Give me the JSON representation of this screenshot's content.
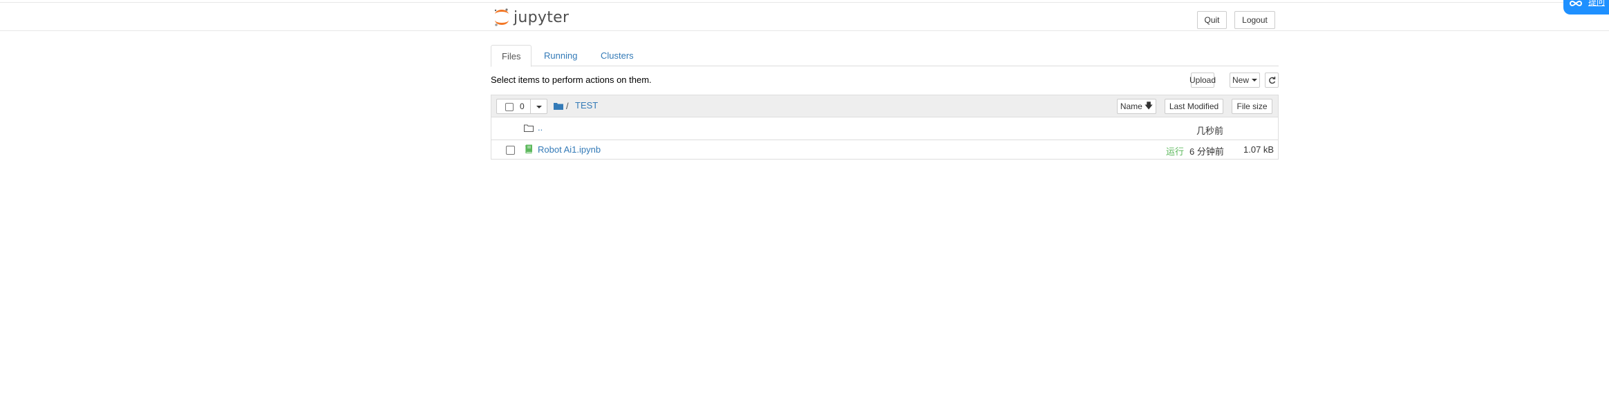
{
  "header": {
    "logo_text": "jupyter",
    "quit_label": "Quit",
    "logout_label": "Logout",
    "corner_label": "提问"
  },
  "tabs": [
    {
      "label": "Files",
      "active": true
    },
    {
      "label": "Running",
      "active": false
    },
    {
      "label": "Clusters",
      "active": false
    }
  ],
  "toolbar": {
    "hint": "Select items to perform actions on them.",
    "upload_label": "Upload",
    "new_label": "New"
  },
  "list_header": {
    "selected_count": "0",
    "breadcrumb_sep": "/",
    "breadcrumb_folder": "TEST",
    "sort_name_label": "Name",
    "sort_modified_label": "Last Modified",
    "sort_size_label": "File size"
  },
  "rows": [
    {
      "name": "..",
      "modified": "几秒前",
      "status": "",
      "size": "",
      "type": "parent-folder"
    },
    {
      "name": "Robot Ai1.ipynb",
      "modified": "6 分钟前",
      "status": "运行",
      "size": "1.07 kB",
      "type": "notebook"
    }
  ],
  "colors": {
    "link": "#337ab7",
    "running_status": "#5cb85c",
    "jupyter_orange": "#f37726",
    "corner_widget": "#1e90ff"
  }
}
